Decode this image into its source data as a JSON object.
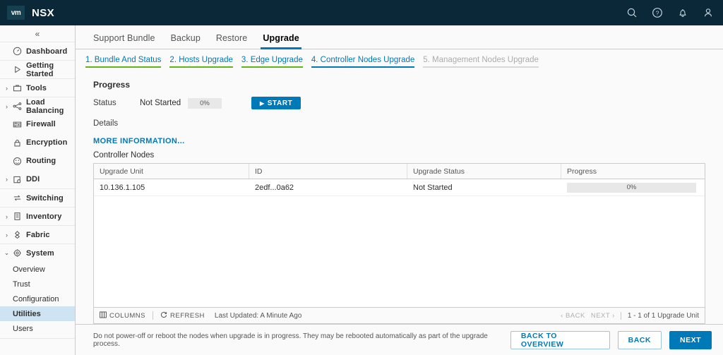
{
  "header": {
    "logo_text": "vm",
    "product": "NSX",
    "icons": [
      {
        "name": "search-icon"
      },
      {
        "name": "help-icon"
      },
      {
        "name": "notification-bell-icon"
      },
      {
        "name": "user-account-icon"
      }
    ]
  },
  "sidebar": {
    "collapse_glyph": "«",
    "items": [
      {
        "label": "Dashboard",
        "icon": "dashboard-icon",
        "expandable": false,
        "separator": true
      },
      {
        "label": "Getting Started",
        "icon": "play-outline-icon",
        "expandable": false,
        "separator": true
      },
      {
        "label": "Tools",
        "icon": "toolbox-icon",
        "expandable": true,
        "separator": false
      },
      {
        "label": "Load Balancing",
        "icon": "load-balancing-icon",
        "expandable": true,
        "separator": true
      },
      {
        "label": "Firewall",
        "icon": "firewall-icon",
        "expandable": false,
        "separator": false
      },
      {
        "label": "Encryption",
        "icon": "lock-icon",
        "expandable": false,
        "separator": false
      },
      {
        "label": "Routing",
        "icon": "routing-icon",
        "expandable": false,
        "separator": false
      },
      {
        "label": "DDI",
        "icon": "ddi-icon",
        "expandable": true,
        "separator": false
      },
      {
        "label": "Switching",
        "icon": "switching-icon",
        "expandable": false,
        "separator": true
      },
      {
        "label": "Inventory",
        "icon": "inventory-icon",
        "expandable": true,
        "separator": true
      },
      {
        "label": "Fabric",
        "icon": "fabric-icon",
        "expandable": true,
        "separator": true
      },
      {
        "label": "System",
        "icon": "system-gear-icon",
        "expandable": true,
        "expanded": true,
        "separator": true
      }
    ],
    "system_children": [
      {
        "label": "Overview",
        "active": false
      },
      {
        "label": "Trust",
        "active": false
      },
      {
        "label": "Configuration",
        "active": false
      },
      {
        "label": "Utilities",
        "active": true
      },
      {
        "label": "Users",
        "active": false
      }
    ]
  },
  "tabs": [
    {
      "label": "Support Bundle",
      "active": false
    },
    {
      "label": "Backup",
      "active": false
    },
    {
      "label": "Restore",
      "active": false
    },
    {
      "label": "Upgrade",
      "active": true
    }
  ],
  "steps": [
    {
      "label": "1. Bundle And Status",
      "state": "done"
    },
    {
      "label": "2. Hosts Upgrade",
      "state": "done"
    },
    {
      "label": "3. Edge Upgrade",
      "state": "done"
    },
    {
      "label": "4. Controller Nodes Upgrade",
      "state": "current"
    },
    {
      "label": "5. Management Nodes Upgrade",
      "state": "disabled"
    }
  ],
  "progress": {
    "section_title": "Progress",
    "status_label": "Status",
    "status_value": "Not Started",
    "percent_label": "0%",
    "start_button": "START",
    "details_label": "Details",
    "more_information": "MORE INFORMATION..."
  },
  "table": {
    "title": "Controller Nodes",
    "columns": [
      "Upgrade Unit",
      "ID",
      "Upgrade Status",
      "Progress"
    ],
    "rows": [
      {
        "upgrade_unit": "10.136.1.105",
        "id": "2edf...0a62",
        "upgrade_status": "Not Started",
        "progress": "0%"
      }
    ],
    "toolbar": {
      "columns_label": "COLUMNS",
      "refresh_label": "REFRESH",
      "last_updated": "Last Updated: A Minute Ago",
      "back_label": "BACK",
      "next_label": "NEXT",
      "count_label": "1 - 1 of 1 Upgrade Unit"
    }
  },
  "footer": {
    "warning": "Do not power-off or reboot the nodes when upgrade is in progress. They may be rebooted automatically as part of the upgrade process.",
    "buttons": [
      {
        "label": "BACK TO OVERVIEW",
        "style": "outline"
      },
      {
        "label": "BACK",
        "style": "outline"
      },
      {
        "label": "NEXT",
        "style": "primary"
      }
    ]
  },
  "colors": {
    "header_bg": "#0b2838",
    "accent_blue": "#0079b8",
    "step_done_green": "#60b515",
    "selected_row": "#cfe4f2"
  }
}
